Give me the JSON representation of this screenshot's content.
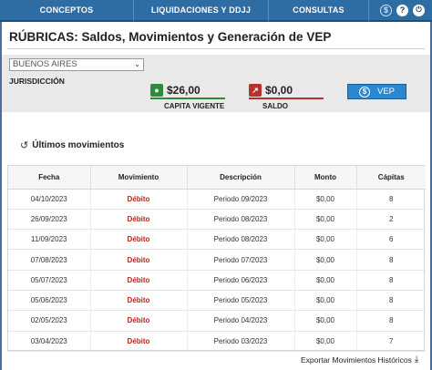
{
  "nav": {
    "items": [
      "CONCEPTOS",
      "LIQUIDACIONES Y DDJJ",
      "CONSULTAS"
    ],
    "icons": [
      "dollar-icon",
      "help-icon",
      "power-icon"
    ]
  },
  "page": {
    "title": "RÚBRICAS: Saldos, Movimientos y Generación de VEP"
  },
  "jurisdiccion": {
    "selected": "BUENOS AIRES",
    "label": "JURISDICCIÓN"
  },
  "amounts": {
    "capita_value": "$26,00",
    "capita_label": "CAPITA VIGENTE",
    "capita_color": "#2e8b3a",
    "saldo_value": "$0,00",
    "saldo_label": "SALDO",
    "saldo_color": "#b8312f"
  },
  "vep_button": {
    "label": "VEP"
  },
  "movimientos": {
    "title": "Últimos movimientos",
    "headers": [
      "Fecha",
      "Movimiento",
      "Descripción",
      "Monto",
      "Cápitas"
    ],
    "rows": [
      [
        "04/10/2023",
        "Débito",
        "Periodo 09/2023",
        "$0,00",
        "8"
      ],
      [
        "26/09/2023",
        "Débito",
        "Periodo 08/2023",
        "$0,00",
        "2"
      ],
      [
        "11/09/2023",
        "Débito",
        "Periodo 08/2023",
        "$0,00",
        "6"
      ],
      [
        "07/08/2023",
        "Débito",
        "Periodo 07/2023",
        "$0,00",
        "8"
      ],
      [
        "05/07/2023",
        "Débito",
        "Periodo 06/2023",
        "$0,00",
        "8"
      ],
      [
        "05/06/2023",
        "Débito",
        "Periodo 05/2023",
        "$0,00",
        "8"
      ],
      [
        "02/05/2023",
        "Débito",
        "Periodo 04/2023",
        "$0,00",
        "8"
      ],
      [
        "03/04/2023",
        "Débito",
        "Periodo 03/2023",
        "$0,00",
        "7"
      ]
    ]
  },
  "export": {
    "label": "Exportar Movimientos Históricos"
  }
}
